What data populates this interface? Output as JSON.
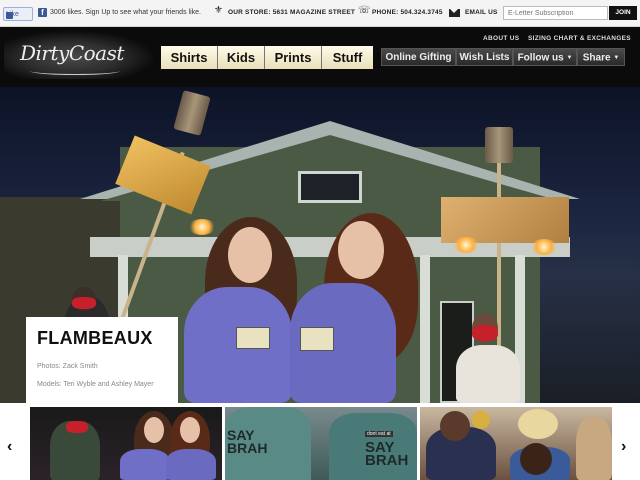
{
  "topbar": {
    "like_label": "Like",
    "fb_icon": "f",
    "fb_text": "3006 likes. Sign Up to see what your friends like.",
    "store_label": "OUR STORE: 5631 MAGAZINE STREET",
    "phone_label": "PHONE: 504.324.3745",
    "email_label": "EMAIL US",
    "newsletter_placeholder": "E-Letter Subscription",
    "join_label": "JOIN",
    "icons": [
      "thumbs-up-icon",
      "facebook-icon",
      "fleur-de-lis-icon",
      "phone-icon",
      "envelope-icon"
    ]
  },
  "header": {
    "logo": "DirtyCoast",
    "links": [
      "ABOUT US",
      "SIZING CHART & EXCHANGES"
    ],
    "nav_main": [
      "Shirts",
      "Kids",
      "Prints",
      "Stuff"
    ],
    "nav_secondary": [
      {
        "label": "Online Gifting",
        "dropdown": false
      },
      {
        "label": "Wish Lists",
        "dropdown": false
      },
      {
        "label": "Follow us",
        "dropdown": true
      },
      {
        "label": "Share",
        "dropdown": true
      }
    ]
  },
  "hero": {
    "title": "FLAMBEAUX",
    "photos_credit": "Photos: Zack Smith",
    "models_credit": "Models: Teri Wyble and Ashley Mayer"
  },
  "strip": {
    "prev_icon": "‹",
    "next_icon": "›",
    "say_text": "SAY\nBRAH",
    "say_tag": "dont eat at"
  },
  "colors": {
    "nav_main_bg": "#f6efcf",
    "header_bg": "#0b0b0b",
    "hero_sky": "#1b2540",
    "shirt_purple": "#6f6fc8"
  }
}
